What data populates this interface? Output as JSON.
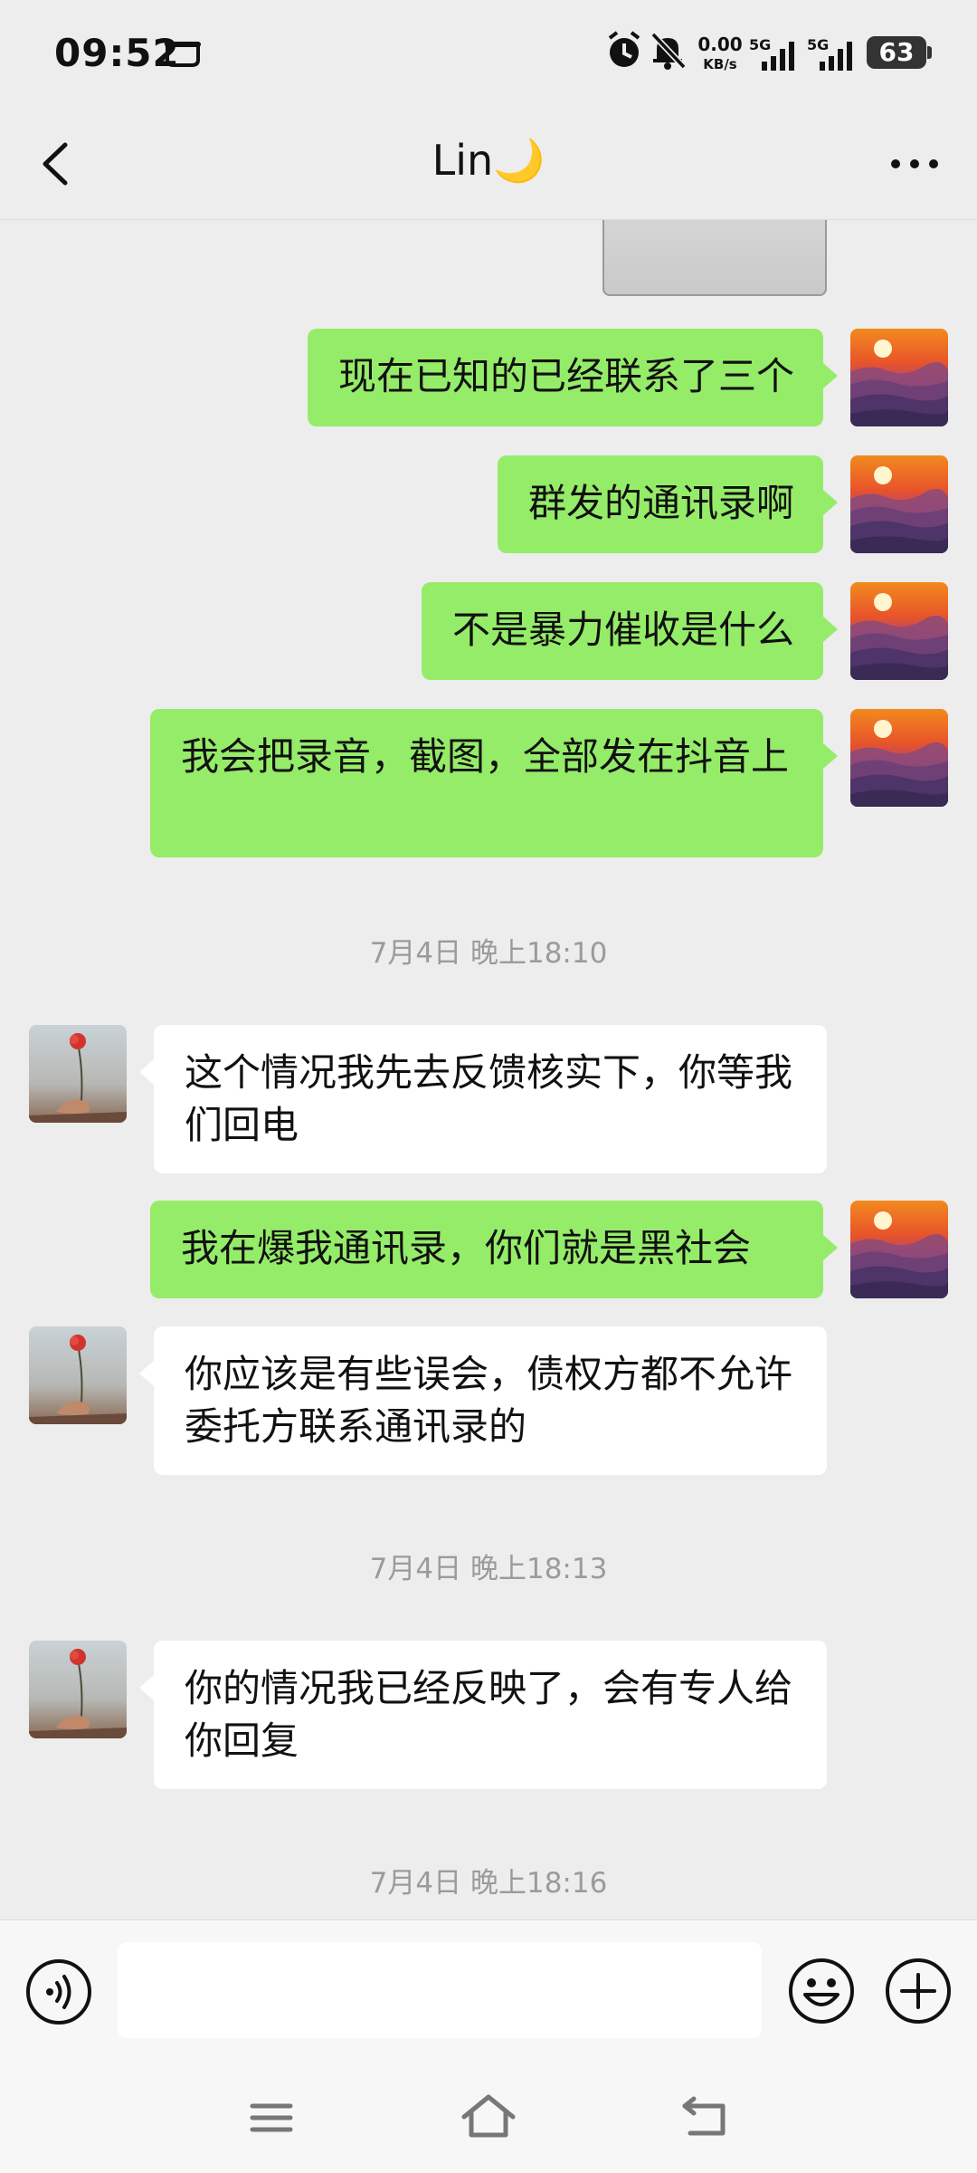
{
  "status_bar": {
    "time": "09:52",
    "net_speed_value": "0.00",
    "net_speed_unit": "KB/s",
    "sim1_label": "5G",
    "sim2_label": "5G",
    "battery": "63",
    "icons": [
      "notification-icon",
      "alarm-icon",
      "mute-icon",
      "signal-icon",
      "signal-icon",
      "battery-icon"
    ]
  },
  "header": {
    "title": "Lin",
    "title_emoji": "🌙",
    "back_icon": "chevron-left-icon",
    "more_icon": "more-dots-icon"
  },
  "messages": [
    {
      "side": "me",
      "text": "现在已知的已经联系了三个"
    },
    {
      "side": "me",
      "text": "群发的通讯录啊"
    },
    {
      "side": "me",
      "text": "不是暴力催收是什么"
    },
    {
      "side": "me",
      "text": "我会把录音，截图，全部发在抖音上"
    },
    {
      "timestamp": "7月4日 晚上18:10"
    },
    {
      "side": "them",
      "text": "这个情况我先去反馈核实下，你等我们回电"
    },
    {
      "side": "me",
      "text": "我在爆我通讯录，你们就是黑社会"
    },
    {
      "side": "them",
      "text": "你应该是有些误会，债权方都不允许委托方联系通讯录的"
    },
    {
      "timestamp": "7月4日 晚上18:13"
    },
    {
      "side": "them",
      "text": "你的情况我已经反映了，会有专人给你回复"
    },
    {
      "timestamp": "7月4日 晚上18:16"
    }
  ],
  "input_bar": {
    "placeholder": "",
    "value": "",
    "icons": [
      "voice-icon",
      "emoji-icon",
      "plus-icon"
    ]
  },
  "system_nav": {
    "icons": [
      "menu-icon",
      "home-icon",
      "back-icon"
    ]
  },
  "colors": {
    "background": "#ededed",
    "my_bubble": "#95ec69",
    "their_bubble": "#ffffff",
    "timestamp_text": "#9b9b9b"
  }
}
